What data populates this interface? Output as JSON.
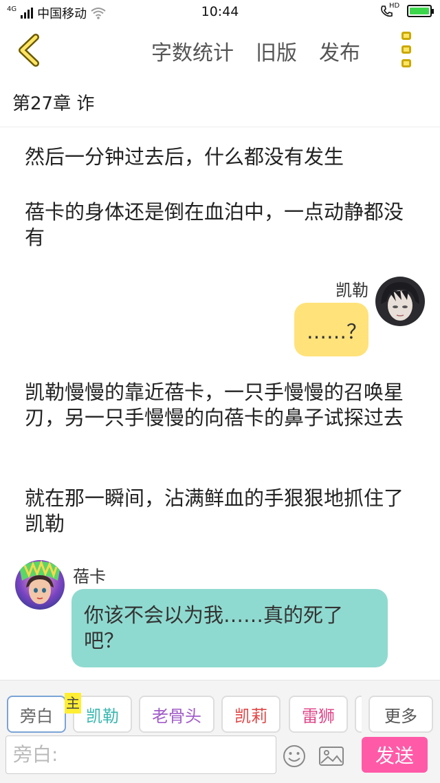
{
  "status_bar": {
    "network": "4G",
    "carrier": "中国移动",
    "time": "10:44",
    "call_badge": "HD",
    "icons": [
      "signal-icon",
      "wifi-icon",
      "hd-call-icon",
      "battery-charging-icon"
    ]
  },
  "toolbar": {
    "back_icon": "chevron-left-icon",
    "word_count_label": "字数统计",
    "old_version_label": "旧版",
    "publish_label": "发布",
    "more_icon": "more-menu-icon",
    "accent_color": "#ffe566"
  },
  "chapter": {
    "title": "第27章  诈"
  },
  "messages": {
    "narration_1": "然后一分钟过去后，什么都没有发生",
    "narration_2": "蓓卡的身体还是倒在血泊中，一点动静都没有",
    "kaile_name": "凯勒",
    "kaile_text": "……？",
    "narration_3": "凯勒慢慢的靠近蓓卡，一只手慢慢的召唤星刃，另一只手慢慢的向蓓卡的鼻子试探过去",
    "narration_4": "就在那一瞬间，沾满鲜血的手狠狠地抓住了凯勒",
    "beika_name": "蓓卡",
    "beika_text": "你该不会以为我……真的死了吧？"
  },
  "role_bar": {
    "roles": [
      {
        "label": "旁白",
        "color": "#666666"
      },
      {
        "label": "凯勒",
        "color": "#3ab7b0"
      },
      {
        "label": "老骨头",
        "color": "#a05cc8"
      },
      {
        "label": "凯莉",
        "color": "#e04848"
      },
      {
        "label": "雷狮",
        "color": "#e0488a"
      }
    ],
    "main_tag": "主",
    "more_label": "更多"
  },
  "composer": {
    "placeholder": "旁白:",
    "emoji_icon": "emoji-icon",
    "image_icon": "image-icon",
    "send_label": "发送",
    "send_color": "#ff5aa8"
  }
}
